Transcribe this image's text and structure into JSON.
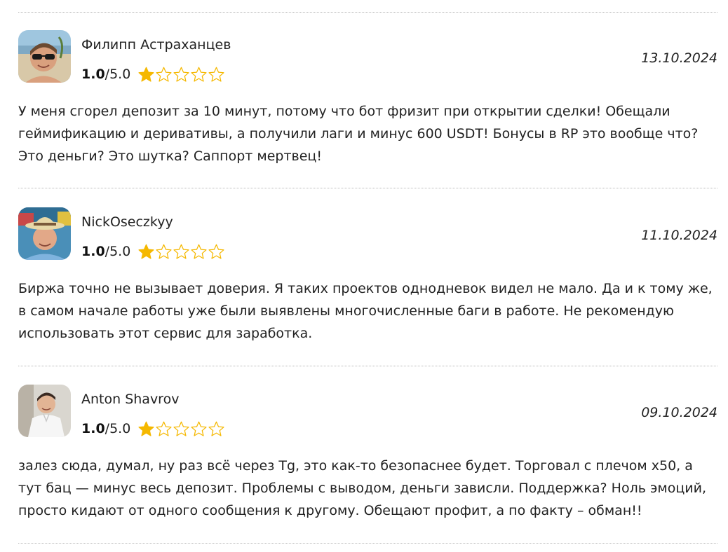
{
  "reviews": [
    {
      "author": "Филипп Астраханцев",
      "rating_value": "1.0",
      "rating_max": "/5.0",
      "stars_filled": 1,
      "stars_total": 5,
      "date": "13.10.2024",
      "text": "У меня сгорел депозит за 10 минут, потому что бот фризит при открытии сделки! Обещали геймификацию и деривативы, а получили лаги и минус 600 USDT! Бонусы в RP это вообще что? Это деньги? Это шутка? Саппорт мертвец!"
    },
    {
      "author": "NickOseczkyy",
      "rating_value": "1.0",
      "rating_max": "/5.0",
      "stars_filled": 1,
      "stars_total": 5,
      "date": "11.10.2024",
      "text": "Биржа точно не вызывает доверия. Я таких проектов однодневок видел не мало. Да и к тому же, в самом начале работы уже были выявлены многочисленные баги в работе. Не рекомендую использовать этот сервис для заработка."
    },
    {
      "author": "Anton Shavrov",
      "rating_value": "1.0",
      "rating_max": "/5.0",
      "stars_filled": 1,
      "stars_total": 5,
      "date": "09.10.2024",
      "text": "залез сюда, думал, ну раз всё через Tg, это как-то безопаснее будет. Торговал с плечом х50, а тут бац — минус весь депозит. Проблемы с выводом, деньги зависли. Поддержка? Ноль эмоций, просто кидают от одного сообщения к другому. Обещают профит, а по факту – обман!!"
    }
  ],
  "colors": {
    "star_fill": "#f5b800",
    "star_outline": "#f5b800",
    "divider": "#b9b9b9",
    "text": "#222222"
  },
  "icons": {
    "star_filled": "star-filled-icon",
    "star_empty": "star-outline-icon"
  }
}
